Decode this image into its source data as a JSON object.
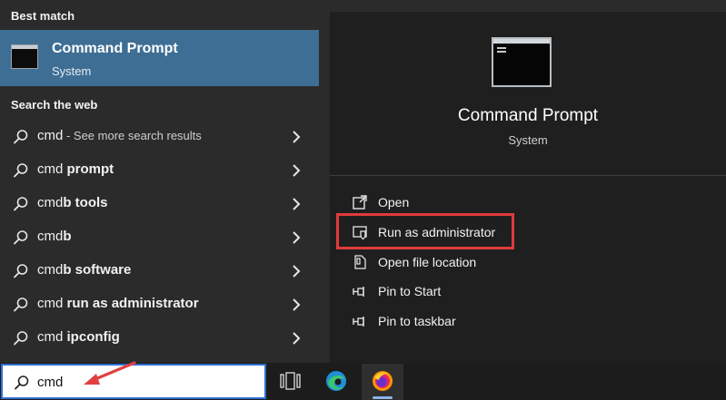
{
  "left_panel": {
    "best_match_heading": "Best match",
    "best_match": {
      "title": "Command Prompt",
      "subtitle": "System"
    },
    "web_heading": "Search the web",
    "web_items": [
      {
        "prefix": "cmd",
        "bold": "",
        "hint": " - See more search results"
      },
      {
        "prefix": "cmd ",
        "bold": "prompt",
        "hint": ""
      },
      {
        "prefix": "cmd",
        "bold": "b tools",
        "hint": ""
      },
      {
        "prefix": "cmd",
        "bold": "b",
        "hint": ""
      },
      {
        "prefix": "cmd",
        "bold": "b software",
        "hint": ""
      },
      {
        "prefix": "cmd ",
        "bold": "run as administrator",
        "hint": ""
      },
      {
        "prefix": "cmd ",
        "bold": "ipconfig",
        "hint": ""
      }
    ]
  },
  "right_panel": {
    "title": "Command Prompt",
    "subtitle": "System",
    "actions": [
      {
        "label": "Open",
        "icon": "open-icon"
      },
      {
        "label": "Run as administrator",
        "icon": "shield-icon"
      },
      {
        "label": "Open file location",
        "icon": "file-location-icon"
      },
      {
        "label": "Pin to Start",
        "icon": "pin-icon"
      },
      {
        "label": "Pin to taskbar",
        "icon": "pin-icon"
      }
    ]
  },
  "search": {
    "value": "cmd"
  },
  "taskbar": {
    "icons": [
      "task-view-icon",
      "edge-icon",
      "firefox-icon"
    ]
  },
  "colors": {
    "selected_bg": "#3e6e94",
    "highlight_red": "#e03b3b",
    "arrow_red": "#e04040"
  }
}
